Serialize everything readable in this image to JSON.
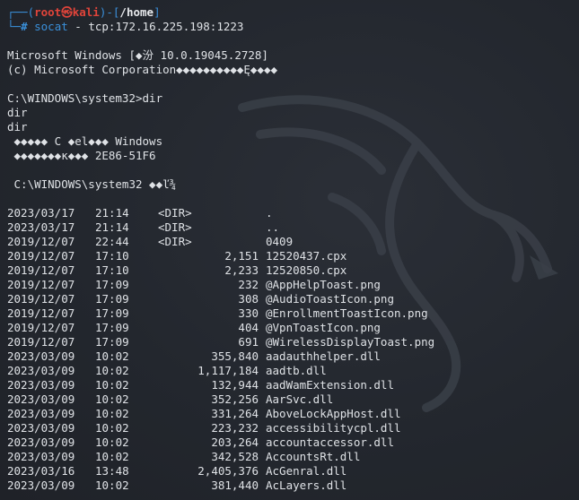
{
  "prompt": {
    "top_frame": "┌──(",
    "user": "root",
    "at_symbol": "㉿",
    "host": "kali",
    "mid_frame": ")-[",
    "cwd": "/home",
    "end_frame": "]",
    "bottom_frame": "└─",
    "hash": "#",
    "command": "socat",
    "args": " - tcp:172.16.225.198:1223"
  },
  "banner": [
    "Microsoft Windows [◆汾 10.0.19045.2728]",
    "(c) Microsoft Corporation◆◆◆◆◆◆◆◆◆◆Ę◆◆◆◆"
  ],
  "session": {
    "cmd_prompt": "C:\\WINDOWS\\system32>dir",
    "echo_lines": [
      "dir",
      "dir"
    ],
    "volume_line": " ◆◆◆◆◆ C ◆el◆◆◆ Windows",
    "serial_line": " ◆◆◆◆◆◆◆к◆◆◆ 2E86-51F6",
    "dir_header": " C:\\WINDOWS\\system32 ◆◆ľ¾"
  },
  "listing": [
    {
      "date": "2023/03/17",
      "time": "21:14",
      "tag": "<DIR>",
      "size": "",
      "name": "."
    },
    {
      "date": "2023/03/17",
      "time": "21:14",
      "tag": "<DIR>",
      "size": "",
      "name": ".."
    },
    {
      "date": "2019/12/07",
      "time": "22:44",
      "tag": "<DIR>",
      "size": "",
      "name": "0409"
    },
    {
      "date": "2019/12/07",
      "time": "17:10",
      "tag": "",
      "size": "2,151",
      "name": "12520437.cpx"
    },
    {
      "date": "2019/12/07",
      "time": "17:10",
      "tag": "",
      "size": "2,233",
      "name": "12520850.cpx"
    },
    {
      "date": "2019/12/07",
      "time": "17:09",
      "tag": "",
      "size": "232",
      "name": "@AppHelpToast.png"
    },
    {
      "date": "2019/12/07",
      "time": "17:09",
      "tag": "",
      "size": "308",
      "name": "@AudioToastIcon.png"
    },
    {
      "date": "2019/12/07",
      "time": "17:09",
      "tag": "",
      "size": "330",
      "name": "@EnrollmentToastIcon.png"
    },
    {
      "date": "2019/12/07",
      "time": "17:09",
      "tag": "",
      "size": "404",
      "name": "@VpnToastIcon.png"
    },
    {
      "date": "2019/12/07",
      "time": "17:09",
      "tag": "",
      "size": "691",
      "name": "@WirelessDisplayToast.png"
    },
    {
      "date": "2023/03/09",
      "time": "10:02",
      "tag": "",
      "size": "355,840",
      "name": "aadauthhelper.dll"
    },
    {
      "date": "2023/03/09",
      "time": "10:02",
      "tag": "",
      "size": "1,117,184",
      "name": "aadtb.dll"
    },
    {
      "date": "2023/03/09",
      "time": "10:02",
      "tag": "",
      "size": "132,944",
      "name": "aadWamExtension.dll"
    },
    {
      "date": "2023/03/09",
      "time": "10:02",
      "tag": "",
      "size": "352,256",
      "name": "AarSvc.dll"
    },
    {
      "date": "2023/03/09",
      "time": "10:02",
      "tag": "",
      "size": "331,264",
      "name": "AboveLockAppHost.dll"
    },
    {
      "date": "2023/03/09",
      "time": "10:02",
      "tag": "",
      "size": "223,232",
      "name": "accessibilitycpl.dll"
    },
    {
      "date": "2023/03/09",
      "time": "10:02",
      "tag": "",
      "size": "203,264",
      "name": "accountaccessor.dll"
    },
    {
      "date": "2023/03/09",
      "time": "10:02",
      "tag": "",
      "size": "342,528",
      "name": "AccountsRt.dll"
    },
    {
      "date": "2023/03/16",
      "time": "13:48",
      "tag": "",
      "size": "2,405,376",
      "name": "AcGenral.dll"
    },
    {
      "date": "2023/03/09",
      "time": "10:02",
      "tag": "",
      "size": "381,440",
      "name": "AcLayers.dll"
    }
  ],
  "colors": {
    "background": "#252930",
    "text": "#dfe2e6",
    "prompt_frame": "#3a8fd9",
    "prompt_user": "#e0443a"
  },
  "icons": {
    "watermark": "kali-dragon-icon"
  }
}
